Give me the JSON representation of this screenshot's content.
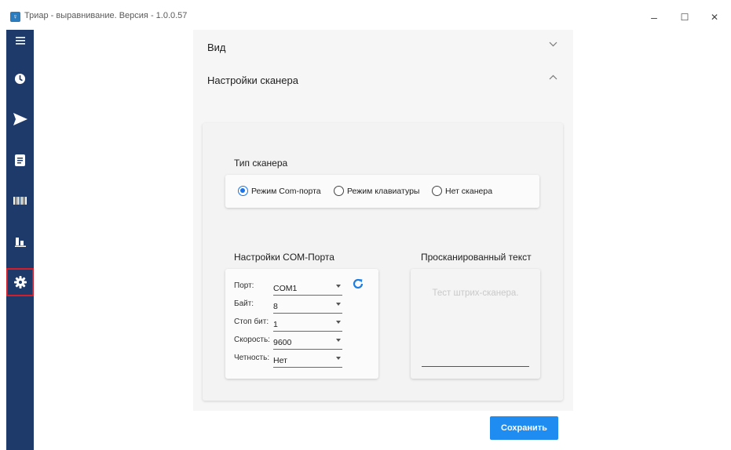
{
  "window": {
    "title": "Триар - выравнивание. Версия - 1.0.0.57",
    "minimize": "–",
    "maximize": "☐",
    "close": "✕"
  },
  "sidebar": {
    "items": [
      {
        "icon": "menu-icon",
        "selected": false
      },
      {
        "icon": "clock-icon",
        "selected": false
      },
      {
        "icon": "send-icon",
        "selected": false
      },
      {
        "icon": "document-icon",
        "selected": false
      },
      {
        "icon": "barcode-icon",
        "selected": false
      },
      {
        "icon": "bar-chart-icon",
        "selected": false
      },
      {
        "icon": "gear-icon",
        "selected": true
      }
    ]
  },
  "accordion": {
    "view_title": "Вид",
    "scanner_title": "Настройки сканера"
  },
  "scanner": {
    "type_label": "Тип сканера",
    "modes": [
      {
        "label": "Режим Com-порта",
        "selected": true
      },
      {
        "label": "Режим клавиатуры",
        "selected": false
      },
      {
        "label": "Нет сканера",
        "selected": false
      }
    ],
    "com_title": "Настройки COM-Порта",
    "scanned_title": "Просканированный текст",
    "scanned_placeholder": "Тест штрих-сканера.",
    "fields": [
      {
        "label": "Порт:",
        "value": "COM1"
      },
      {
        "label": "Байт:",
        "value": "8"
      },
      {
        "label": "Стоп бит:",
        "value": "1"
      },
      {
        "label": "Скорость:",
        "value": "9600"
      },
      {
        "label": "Четность:",
        "value": "Нет"
      }
    ]
  },
  "actions": {
    "save_label": "Сохранить"
  },
  "colors": {
    "sidebar": "#1d3a6b",
    "accent": "#1e8cf0",
    "selected_outline": "#d41f2b"
  }
}
